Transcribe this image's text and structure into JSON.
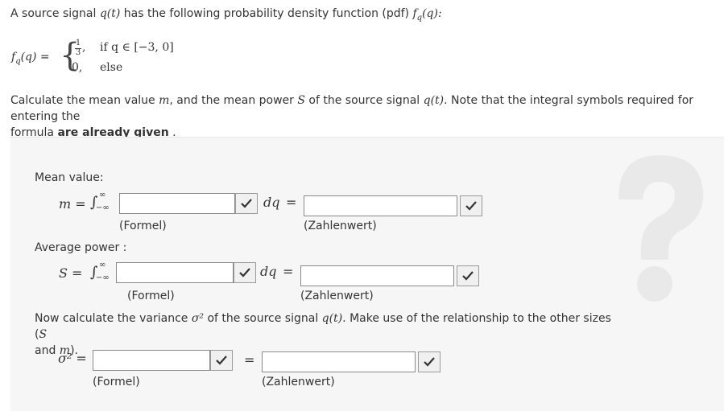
{
  "intro": {
    "text_before": "A source signal ",
    "signal": "q(t)",
    "text_after": " has the following probability density function (pdf) ",
    "pdf": "f",
    "pdf_sub": "q",
    "pdf_arg": "(q):"
  },
  "pdf_definition": {
    "lhs": "f",
    "lhs_sub": "q",
    "lhs_arg": "(q) =",
    "case1_value_num": "1",
    "case1_value_den": "3",
    "case1_condition": "if q ∈ [−3, 0]",
    "case2_value": "0,",
    "case2_condition": "else"
  },
  "calc": {
    "text1": "Calculate the mean value ",
    "m": "m",
    "text2": ", and the mean power ",
    "S": "S",
    "text3": " of the source signal ",
    "signal": "q(t)",
    "text4": ". Note that the integral symbols required for entering the",
    "text5": "formula ",
    "bold": "are already given",
    "text6": " ."
  },
  "mean": {
    "label": "Mean value:",
    "lhs": "m =",
    "integral": "∫",
    "upper": "∞",
    "lower": "−∞",
    "dq": "dq",
    "eq": "=",
    "formula_hint": "(Formel)",
    "value_hint": "(Zahlenwert)",
    "formula_value": "",
    "numeric_value": ""
  },
  "power": {
    "label": "Average power :",
    "lhs": "S =",
    "integral": "∫",
    "upper": "∞",
    "lower": "−∞",
    "dq": "dq",
    "eq": "=",
    "formula_hint": "(Formel)",
    "value_hint": "(Zahlenwert)",
    "formula_value": "",
    "numeric_value": ""
  },
  "variance": {
    "text1": "Now calculate the variance ",
    "sigma": "σ²",
    "text2": " of the source signal ",
    "signal": "q(t)",
    "text3": ". Make use of the relationship to the other sizes (",
    "S": "S",
    "text4": "and ",
    "m": "m",
    "text5": ").",
    "lhs": "σ² =",
    "eq": "=",
    "formula_hint": "(Formel)",
    "value_hint": "(Zahlenwert)",
    "formula_value": "",
    "numeric_value": ""
  },
  "icons": {
    "check": "checkmark-icon",
    "help": "question-mark-icon"
  },
  "colors": {
    "box_background": "#f6f6f6",
    "question_mark": "#e9e9e9",
    "check_mark": "#333333"
  }
}
